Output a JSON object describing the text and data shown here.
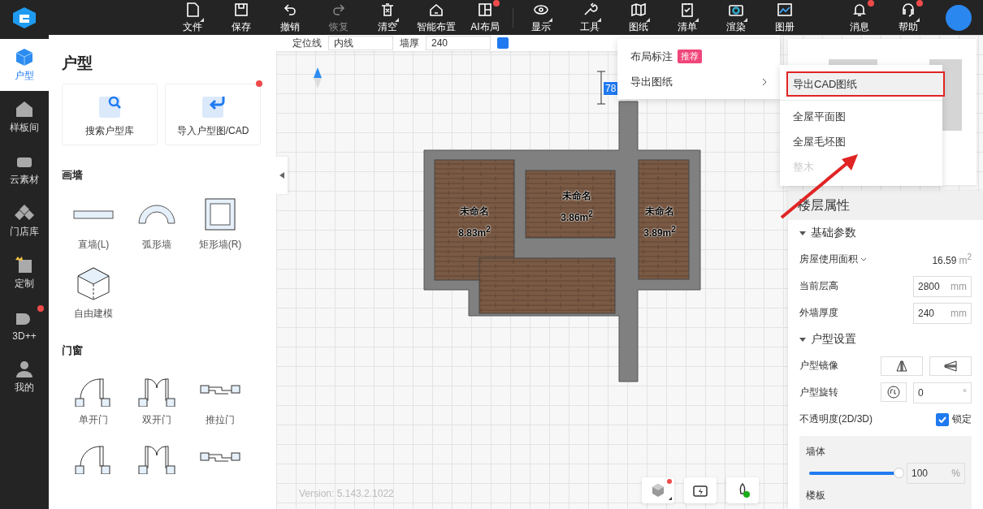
{
  "top_bar": {
    "tools": [
      {
        "label": "文件",
        "dropdown": true,
        "dot": false,
        "disabled": false
      },
      {
        "label": "保存",
        "dropdown": false,
        "dot": false,
        "disabled": false
      },
      {
        "label": "撤销",
        "dropdown": false,
        "dot": false,
        "disabled": false
      },
      {
        "label": "恢复",
        "dropdown": false,
        "dot": false,
        "disabled": true
      },
      {
        "label": "清空",
        "dropdown": true,
        "dot": false,
        "disabled": false
      },
      {
        "label": "智能布置",
        "dropdown": false,
        "dot": false,
        "disabled": false
      },
      {
        "label": "AI布局",
        "dropdown": false,
        "dot": true,
        "disabled": false
      }
    ],
    "tools_2": [
      {
        "label": "显示",
        "dropdown": true,
        "dot": false,
        "disabled": false
      },
      {
        "label": "工具",
        "dropdown": true,
        "dot": false,
        "disabled": false
      },
      {
        "label": "图纸",
        "dropdown": true,
        "dot": false,
        "disabled": false
      },
      {
        "label": "清单",
        "dropdown": true,
        "dot": false,
        "disabled": false
      },
      {
        "label": "渲染",
        "dropdown": true,
        "dot": false,
        "disabled": false
      },
      {
        "label": "图册",
        "dropdown": false,
        "dot": false,
        "disabled": false
      }
    ],
    "right_tools": [
      {
        "label": "消息",
        "dropdown": false,
        "dot": true,
        "disabled": false
      },
      {
        "label": "帮助",
        "dropdown": true,
        "dot": true,
        "disabled": false
      }
    ]
  },
  "edit_toolbar": {
    "fields": [
      {
        "label": "定位线",
        "value": "内线"
      },
      {
        "label": "墙厚",
        "value": "240"
      }
    ],
    "checkbox": {
      "checked": true
    }
  },
  "rail": [
    {
      "label": "户型",
      "selected": true,
      "dot": false
    },
    {
      "label": "样板间",
      "selected": false,
      "dot": false
    },
    {
      "label": "云素材",
      "selected": false,
      "dot": false
    },
    {
      "label": "门店库",
      "selected": false,
      "dot": false
    },
    {
      "label": "定制",
      "selected": false,
      "dot": false
    },
    {
      "label": "3D++",
      "selected": false,
      "dot": true
    },
    {
      "label": "我的",
      "selected": false,
      "dot": false
    }
  ],
  "panel": {
    "title": "户型",
    "cards": [
      {
        "label": "搜索户型库",
        "dot": false
      },
      {
        "label": "导入户型图/CAD",
        "dot": true
      }
    ],
    "sections": [
      {
        "title": "画墙",
        "items": [
          "直墙(L)",
          "弧形墙",
          "矩形墙(R)",
          "自由建模"
        ]
      },
      {
        "title": "门窗",
        "items": [
          "单开门",
          "双开门",
          "推拉门"
        ]
      }
    ]
  },
  "canvas": {
    "rooms": [
      {
        "name": "未命名",
        "area": "8.83m$^{2}$"
      },
      {
        "name": "未命名",
        "area": "3.86m$^{2}$"
      },
      {
        "name": "未命名",
        "area": "3.89m$^{2}$"
      }
    ],
    "dimension": "78",
    "version": "Version: 5.143.2.1022",
    "bottom_tools": [
      {
        "dot": true,
        "dropdown": true
      },
      {
        "dot": false,
        "dropdown": false
      },
      {
        "dot": false,
        "dropdown": false
      }
    ]
  },
  "menu": {
    "items": [
      {
        "label": "布局标注",
        "badge": "推荐",
        "submenu": false
      },
      {
        "label": "导出图纸",
        "submenu": true
      }
    ]
  },
  "submenu": {
    "items": [
      {
        "label": "导出CAD图纸",
        "selected": true,
        "disabled": false
      },
      {
        "label": "全屋平面图",
        "selected": false,
        "disabled": false
      },
      {
        "label": "全屋毛坯图",
        "selected": false,
        "disabled": false
      },
      {
        "label": "整木",
        "selected": false,
        "disabled": true
      }
    ]
  },
  "properties": {
    "title": "楼层属性",
    "sections": [
      {
        "title": "基础参数",
        "expanded": true,
        "rows": [
          {
            "kind": "value",
            "label": "房屋使用面积",
            "value": "16.59",
            "unit": "m$^{2}$"
          },
          {
            "kind": "input",
            "label": "当前层高",
            "value": "2800",
            "unit": "mm"
          },
          {
            "kind": "input",
            "label": "外墙厚度",
            "value": "240",
            "unit": "mm"
          }
        ]
      },
      {
        "title": "户型设置",
        "expanded": true,
        "rows": [
          {
            "kind": "mirror",
            "label": "户型镜像"
          },
          {
            "kind": "rotate",
            "label": "户型旋转",
            "value": "0",
            "unit": "°"
          },
          {
            "kind": "check",
            "label": "不透明度(2D/3D)",
            "check_label": "锁定",
            "checked": true
          }
        ]
      }
    ],
    "opacity": [
      {
        "kind": "slider",
        "label": "墙体",
        "level": 1,
        "value": "100",
        "unit": "%"
      },
      {
        "kind": "label",
        "label": "楼板"
      }
    ]
  }
}
